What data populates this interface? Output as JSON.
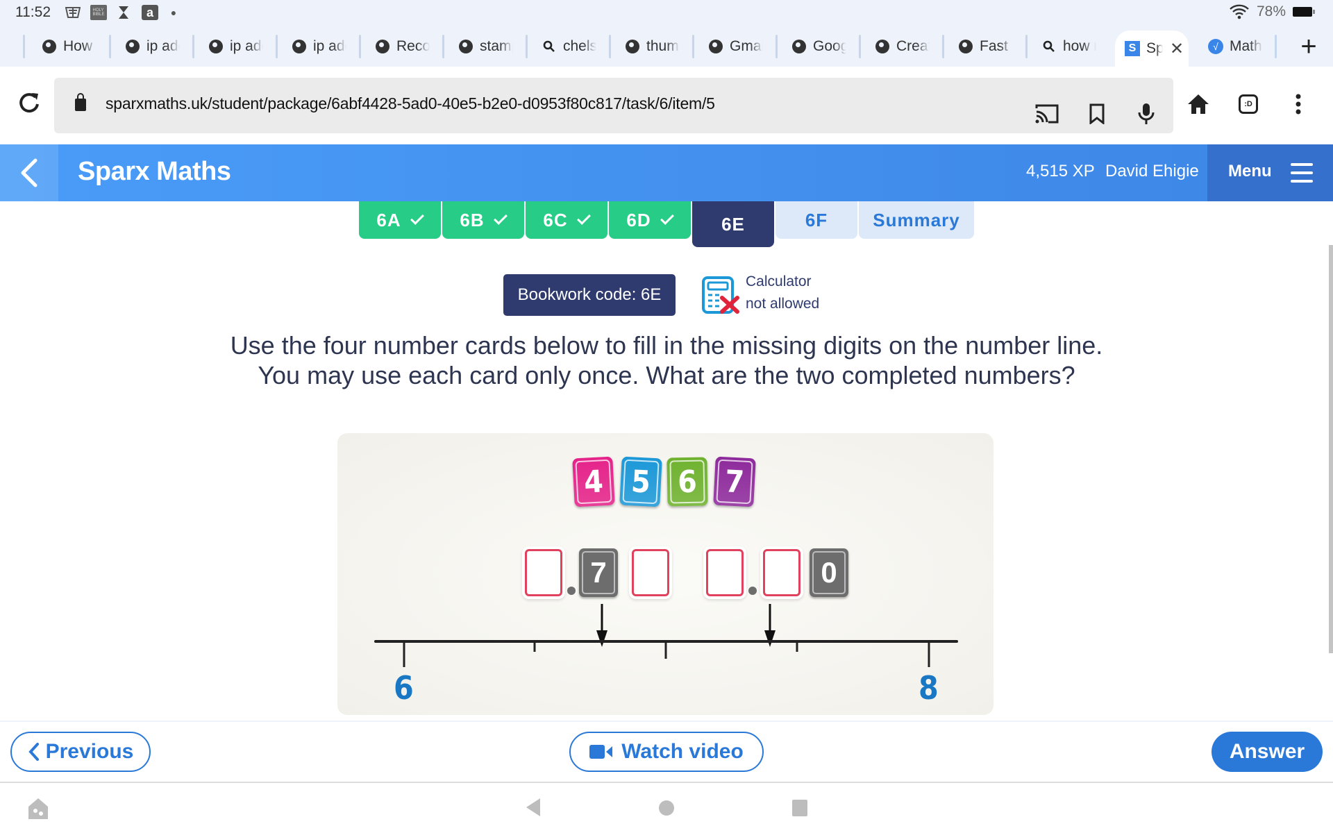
{
  "status_bar": {
    "time": "11:52",
    "icons": [
      "kb-app-icon",
      "bible-app-icon",
      "hourglass-icon",
      "amazon-icon",
      "dot-icon"
    ],
    "wifi_icon": "wifi-icon",
    "battery_percent": "78%"
  },
  "browser": {
    "tabs": [
      {
        "icon": "globe-icon",
        "label": "How do"
      },
      {
        "icon": "globe-icon",
        "label": "ip addr"
      },
      {
        "icon": "globe-icon",
        "label": "ip addr"
      },
      {
        "icon": "globe-icon",
        "label": "ip addr"
      },
      {
        "icon": "globe-icon",
        "label": "Record"
      },
      {
        "icon": "globe-icon",
        "label": "stamp"
      },
      {
        "icon": "search-icon",
        "label": "chelse"
      },
      {
        "icon": "globe-icon",
        "label": "thumb"
      },
      {
        "icon": "globe-icon",
        "label": "Gmail"
      },
      {
        "icon": "globe-icon",
        "label": "Googl"
      },
      {
        "icon": "globe-icon",
        "label": "Creat"
      },
      {
        "icon": "globe-icon",
        "label": "Fast c"
      },
      {
        "icon": "search-icon",
        "label": "how r"
      },
      {
        "icon": "sparx-icon",
        "label": "Sparx",
        "active": true
      },
      {
        "icon": "math-icon",
        "label": "Math"
      }
    ],
    "new_tab_glyph": "+",
    "close_glyph": "✕",
    "url": "sparxmaths.uk/student/package/6abf4428-5ad0-40e5-b2e0-d0953f80c817/task/6/item/5",
    "toolbar_icons": [
      "cast-icon",
      "bookmark-icon",
      "mic-icon",
      "home-icon",
      "extension-icon",
      "more-icon"
    ],
    "extension_label": ":D"
  },
  "header": {
    "brand": "Sparx Maths",
    "xp": "4,515 XP",
    "user": "David Ehigie",
    "menu_label": "Menu"
  },
  "task_tabs": [
    {
      "label": "6A",
      "status": "done"
    },
    {
      "label": "6B",
      "status": "done"
    },
    {
      "label": "6C",
      "status": "done"
    },
    {
      "label": "6D",
      "status": "done"
    },
    {
      "label": "6E",
      "status": "current"
    },
    {
      "label": "6F",
      "status": "todo"
    },
    {
      "label": "Summary",
      "status": "todo"
    }
  ],
  "bookwork": {
    "label": "Bookwork code: 6E"
  },
  "calculator": {
    "line1": "Calculator",
    "line2": "not allowed"
  },
  "question": {
    "line1": "Use the four number cards below to fill in the missing digits on the number line.",
    "line2": "You may use each card only once. What are the two completed numbers?"
  },
  "figure": {
    "cards": [
      {
        "digit": "4",
        "color": "#e5238a"
      },
      {
        "digit": "5",
        "color": "#1c98d8"
      },
      {
        "digit": "6",
        "color": "#6fb22f"
      },
      {
        "digit": "7",
        "color": "#8e2a9c"
      }
    ],
    "number_a": {
      "given_tenths": "7"
    },
    "number_b": {
      "given_hundredths": "0"
    },
    "number_line": {
      "start_label": "6",
      "end_label": "8"
    }
  },
  "actions": {
    "previous": "Previous",
    "watch_video": "Watch video",
    "answer": "Answer"
  },
  "colors": {
    "brand_blue": "#3d86e6",
    "navy": "#2f3b6e",
    "done_green": "#27cc87",
    "action_blue": "#2a79d8"
  }
}
